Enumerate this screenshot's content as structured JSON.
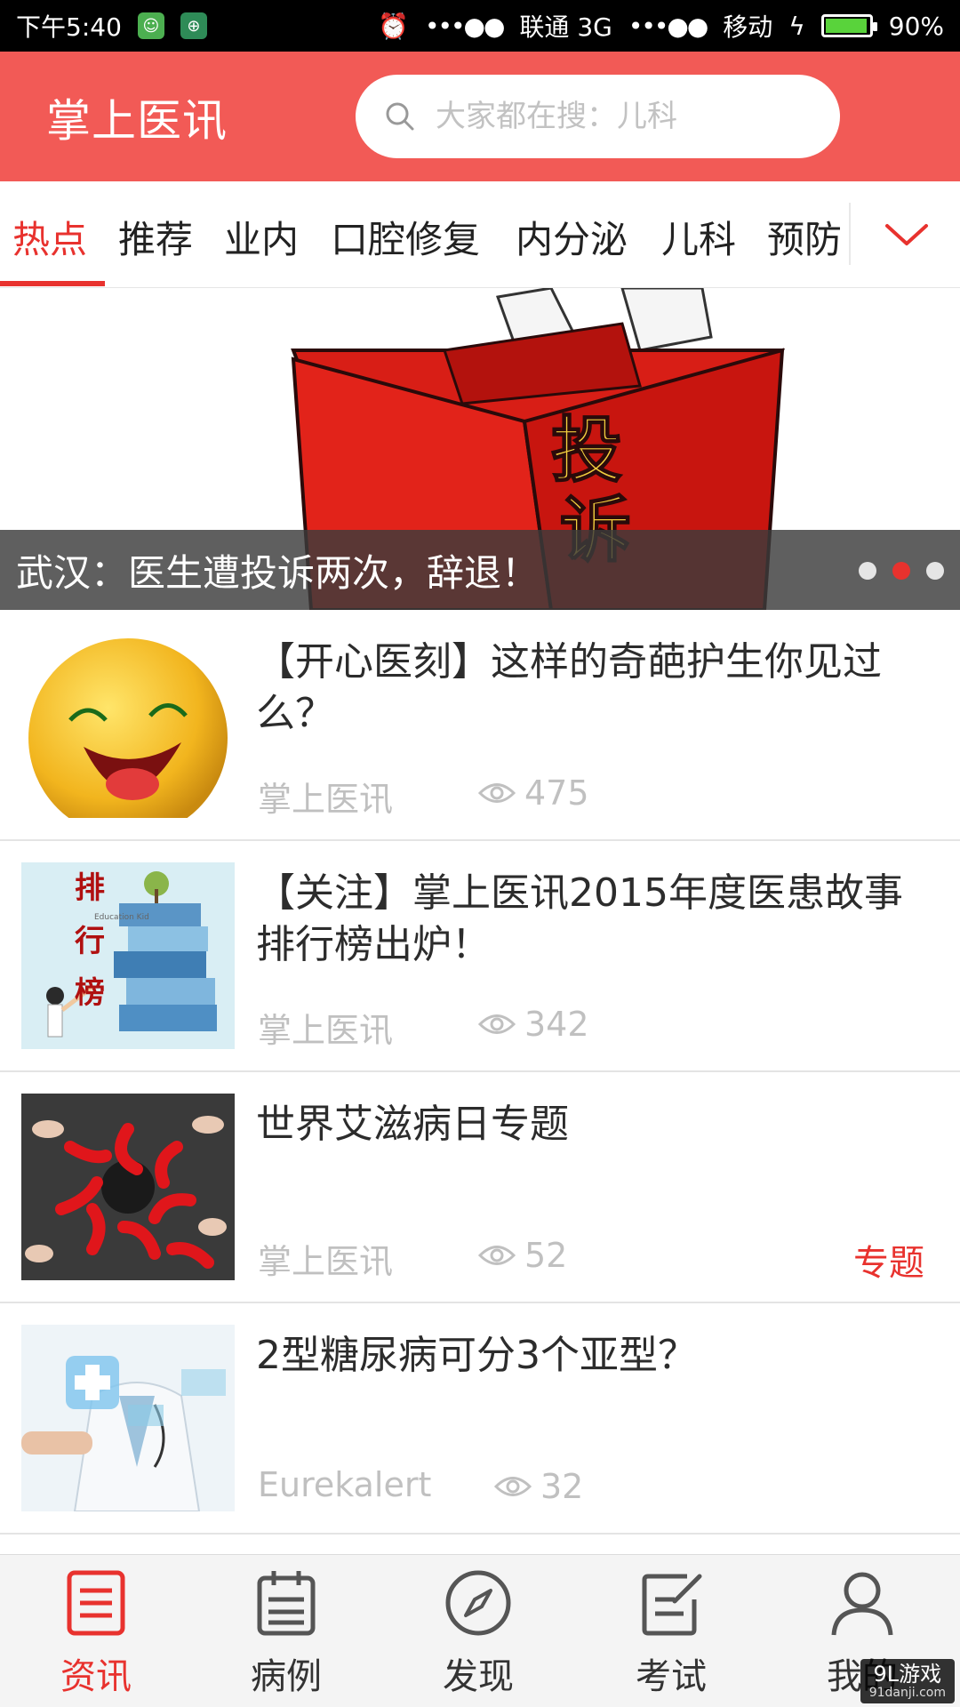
{
  "status_bar": {
    "time": "下午5:40",
    "carrier1": "联通 3G",
    "carrier2": "移动",
    "battery": "90%",
    "battery_level": 0.9
  },
  "header": {
    "title": "掌上医讯",
    "search_placeholder": "大家都在搜：儿科"
  },
  "tabs": {
    "items": [
      "热点",
      "推荐",
      "业内",
      "口腔修复",
      "内分泌",
      "儿科",
      "预防"
    ],
    "active_index": 0
  },
  "banner": {
    "caption": "武汉：医生遭投诉两次，辞退！",
    "box_text": "投诉",
    "active_dot": 1,
    "dot_count": 3
  },
  "news": [
    {
      "title": "【开心医刻】这样的奇葩护生你见过么？",
      "source": "掌上医讯",
      "views": "475",
      "thumb": "smiley"
    },
    {
      "title": "【关注】掌上医讯2015年度医患故事排行榜出炉！",
      "source": "掌上医讯",
      "views": "342",
      "thumb": "ranking",
      "thumb_text": "排行榜",
      "thumb_small": "Education Kid"
    },
    {
      "title": "世界艾滋病日专题",
      "source": "掌上医讯",
      "views": "52",
      "tag": "专题",
      "thumb": "ribbons"
    },
    {
      "title": "2型糖尿病可分3个亚型？",
      "source": "Eurekalert",
      "views": "32",
      "thumb": "doctor"
    }
  ],
  "bottom_nav": {
    "items": [
      {
        "label": "资讯",
        "icon": "news-icon"
      },
      {
        "label": "病例",
        "icon": "calendar-icon"
      },
      {
        "label": "发现",
        "icon": "compass-icon"
      },
      {
        "label": "考试",
        "icon": "exam-icon"
      },
      {
        "label": "我的",
        "icon": "user-icon"
      }
    ],
    "active_index": 0
  },
  "watermark": {
    "text": "9L游戏",
    "url": "91danji.com"
  },
  "colors": {
    "accent": "#f25a56",
    "active_red": "#e8322e"
  }
}
